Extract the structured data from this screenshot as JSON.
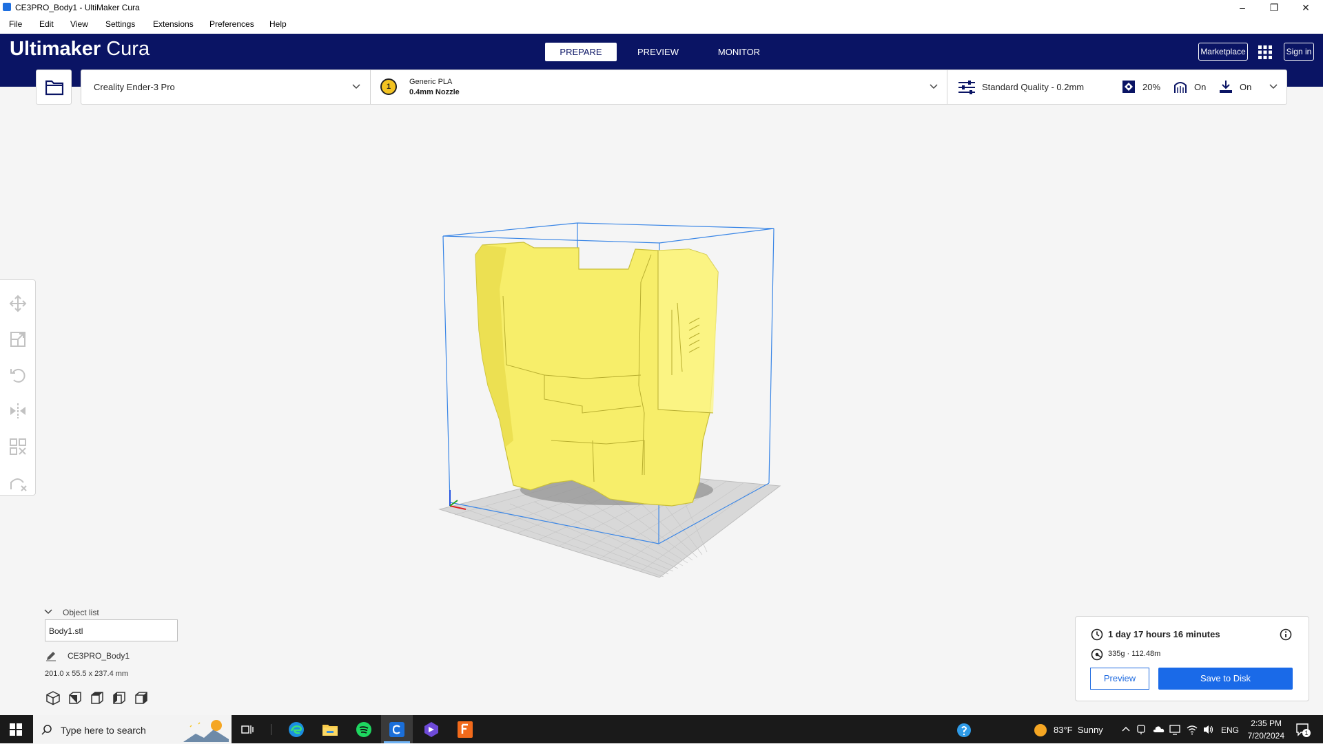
{
  "window": {
    "title": "CE3PRO_Body1 - UltiMaker Cura"
  },
  "menu": [
    "File",
    "Edit",
    "View",
    "Settings",
    "Extensions",
    "Preferences",
    "Help"
  ],
  "header": {
    "brand_bold": "Ultimaker",
    "brand_light": "Cura",
    "tabs": [
      "PREPARE",
      "PREVIEW",
      "MONITOR"
    ],
    "marketplace": "Marketplace",
    "sign_in": "Sign in"
  },
  "printer": {
    "name": "Creality Ender-3 Pro"
  },
  "material": {
    "extruder_num": "1",
    "name": "Generic PLA",
    "nozzle": "0.4mm Nozzle"
  },
  "settings": {
    "quality": "Standard Quality - 0.2mm",
    "infill": "20%",
    "support": "On",
    "adhesion": "On"
  },
  "object_list": {
    "label": "Object list",
    "item": "Body1.stl",
    "job_name": "CE3PRO_Body1",
    "dimensions": "201.0 x 55.5 x 237.4 mm"
  },
  "print": {
    "time": "1 day 17 hours 16 minutes",
    "material": "335g · 112.48m",
    "preview_label": "Preview",
    "save_label": "Save to Disk"
  },
  "taskbar": {
    "search_placeholder": "Type here to search",
    "weather": "83°F  Sunny",
    "lang": "ENG",
    "time": "2:35 PM",
    "date": "7/20/2024",
    "notif_count": "1"
  },
  "colors": {
    "header": "#0a1464",
    "accent": "#1a6ae8",
    "model": "#f8f06a",
    "buildvolume": "#3a86e6"
  }
}
